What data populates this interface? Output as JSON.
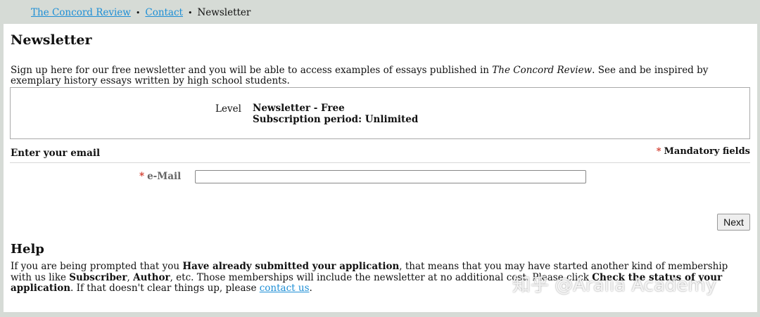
{
  "breadcrumb": {
    "items": [
      {
        "label": "The Concord Review"
      },
      {
        "label": "Contact"
      },
      {
        "label": "Newsletter"
      }
    ],
    "separator": "•"
  },
  "page": {
    "title": "Newsletter",
    "intro_prefix": "Sign up here for our free newsletter and you will be able to access examples of essays published in ",
    "intro_italic": "The Concord Review",
    "intro_suffix": ".  See and be inspired by exemplary history essays written by high school students."
  },
  "level": {
    "label": "Level",
    "name": "Newsletter - Free",
    "period": "Subscription period: Unlimited"
  },
  "email_section": {
    "heading": "Enter your email",
    "mandatory_label": "Mandatory fields",
    "required_marker": "*",
    "field_label": "e-Mail",
    "field_value": ""
  },
  "actions": {
    "next_label": "Next"
  },
  "help": {
    "title": "Help",
    "t1": "If you are being prompted that you ",
    "b1": "Have already submitted your application",
    "t2": ", that means that you may have started another kind of membership with us like ",
    "b2": "Subscriber",
    "t3": ", ",
    "b3": "Author",
    "t4": ", etc.  Those memberships will include the newsletter at no additional cost.  Please click ",
    "b4": "Check the status of your application",
    "t5": ".  If that doesn't clear things up, please ",
    "link": "contact us",
    "t6": "."
  },
  "watermark": {
    "text": "知乎 @Aralia Academy"
  },
  "colors": {
    "link": "#1e8fd6",
    "required": "#d23a2c",
    "background": "#d6dbd6"
  }
}
